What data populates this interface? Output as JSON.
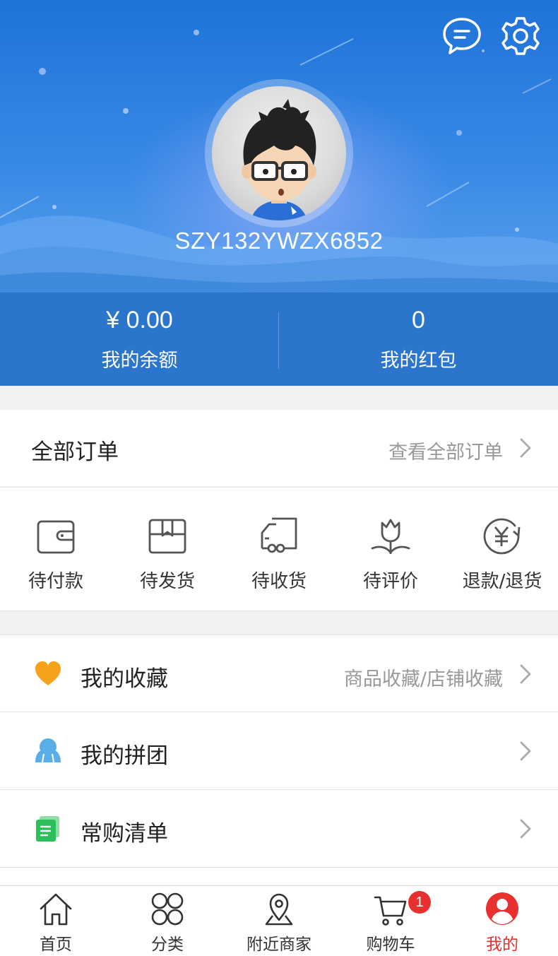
{
  "header": {
    "username": "SZY132YWZX6852",
    "icons": [
      "message-icon",
      "settings-gear-icon"
    ]
  },
  "stats": {
    "balance_value": "¥ 0.00",
    "balance_label": "我的余额",
    "redpacket_value": "0",
    "redpacket_label": "我的红包"
  },
  "orders": {
    "title": "全部订单",
    "view_all": "查看全部订单",
    "items": [
      {
        "label": "待付款",
        "icon": "wallet-icon"
      },
      {
        "label": "待发货",
        "icon": "package-icon"
      },
      {
        "label": "待收货",
        "icon": "truck-icon"
      },
      {
        "label": "待评价",
        "icon": "flower-icon"
      },
      {
        "label": "退款/退货",
        "icon": "yuan-refund-icon"
      }
    ]
  },
  "menu": [
    {
      "title": "我的收藏",
      "sub": "商品收藏/店铺收藏",
      "icon": "heart-icon",
      "color": "#f6a21a"
    },
    {
      "title": "我的拼团",
      "sub": "",
      "icon": "group-icon",
      "color": "#5aaee8"
    },
    {
      "title": "常购清单",
      "sub": "",
      "icon": "list-icon",
      "color": "#2dbf5b"
    }
  ],
  "tabbar": {
    "items": [
      {
        "label": "首页",
        "icon": "home-icon"
      },
      {
        "label": "分类",
        "icon": "category-icon"
      },
      {
        "label": "附近商家",
        "icon": "location-icon"
      },
      {
        "label": "购物车",
        "icon": "cart-icon"
      },
      {
        "label": "我的",
        "icon": "user-icon"
      }
    ],
    "active_index": 4,
    "cart_badge": "1",
    "active_color": "#e8302e"
  }
}
